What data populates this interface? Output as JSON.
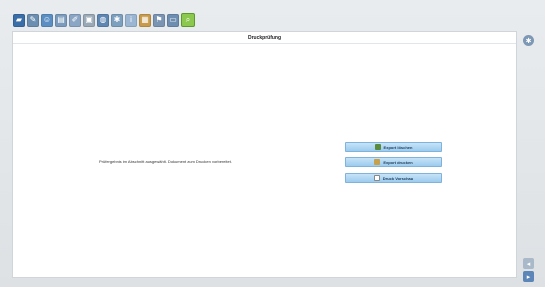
{
  "window": {
    "title": "Druckprüfung"
  },
  "toolbar": {
    "items": [
      {
        "name": "monitor-icon",
        "glyph": "▰",
        "color": "#3a6ea8"
      },
      {
        "name": "tools-icon",
        "glyph": "✎",
        "color": "#6c8fb1"
      },
      {
        "name": "users-icon",
        "glyph": "☺",
        "color": "#5b8fc4"
      },
      {
        "name": "chart-icon",
        "glyph": "▤",
        "color": "#7a9bbd"
      },
      {
        "name": "edit-icon",
        "glyph": "✐",
        "color": "#8aa6c4"
      },
      {
        "name": "stamp-icon",
        "glyph": "▣",
        "color": "#9aa9b7"
      },
      {
        "name": "globe-icon",
        "glyph": "◍",
        "color": "#5e86b3"
      },
      {
        "name": "settings-icon",
        "glyph": "✱",
        "color": "#7da0bf"
      },
      {
        "name": "info-icon",
        "glyph": "i",
        "color": "#9ab6d3"
      },
      {
        "name": "package-icon",
        "glyph": "▦",
        "color": "#c89a4b"
      },
      {
        "name": "flag-icon",
        "glyph": "⚑",
        "color": "#7a95b4"
      },
      {
        "name": "window-icon",
        "glyph": "▭",
        "color": "#6d8eb0"
      },
      {
        "name": "search-icon",
        "glyph": "⌕",
        "color": "#8dc84e",
        "active": true
      }
    ]
  },
  "main": {
    "message": "Prüfergebnis im Abschnitt ausgewählt. Dokument zum Drucken vorbereitet.",
    "buttons": {
      "search_label": "Export löschen",
      "print_label": "Export drucken",
      "preview_label": "Druck Vorschau"
    }
  },
  "side": {
    "gear_icon": "gear-icon",
    "nav_left_icon": "arrow-left-icon",
    "nav_right_icon": "arrow-right-icon"
  },
  "colors": {
    "accent": "#8dc84e",
    "button_bg": "#9ccbee",
    "panel_bg": "#ffffff"
  }
}
